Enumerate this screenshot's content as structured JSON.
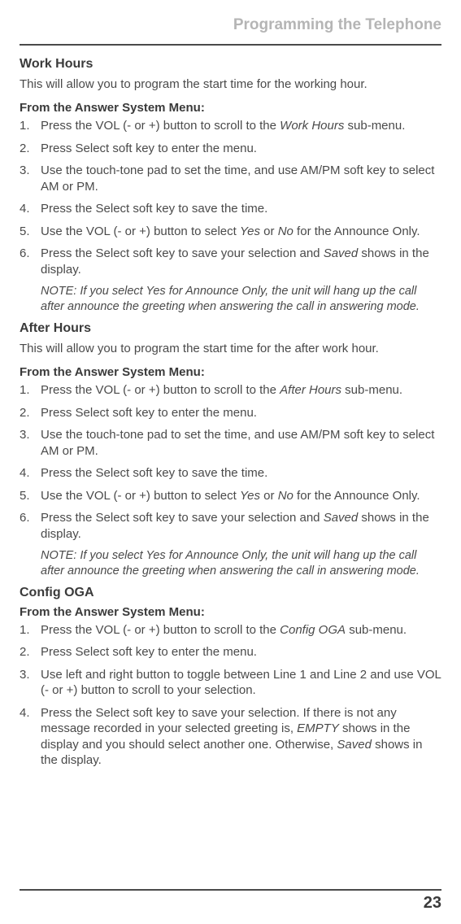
{
  "header": {
    "title": "Programming the Telephone"
  },
  "workHours": {
    "heading": "Work Hours",
    "intro": "This will allow you to program the start time for the working hour.",
    "subHeading": "From the Answer System Menu:",
    "steps": {
      "s1a": "Press the VOL (- or +) button to scroll to the ",
      "s1b": "Work Hours",
      "s1c": " sub-menu.",
      "s2": "Press Select soft key to enter the menu.",
      "s3": "Use the touch-tone pad to set the time, and use AM/PM soft key to select AM or PM.",
      "s4": "Press the Select soft key to save the time.",
      "s5a": "Use the VOL (- or +) button to select ",
      "s5b": "Yes",
      "s5c": " or ",
      "s5d": "No",
      "s5e": " for the Announce Only.",
      "s6a": "Press the Select soft key to save your selection and ",
      "s6b": "Saved",
      "s6c": " shows in the display."
    },
    "note": "NOTE: If you select Yes for Announce Only, the unit will hang up the call after announce the greeting when answering the call in answering mode."
  },
  "afterHours": {
    "heading": "After Hours",
    "intro": "This will allow you to program the start time for the after work hour.",
    "subHeading": "From the Answer System Menu:",
    "steps": {
      "s1a": "Press the VOL (- or +) button to scroll to the ",
      "s1b": "After Hours",
      "s1c": " sub-menu.",
      "s2": "Press Select soft key to enter the menu.",
      "s3": "Use the touch-tone pad to set the time, and use AM/PM soft key to select AM or PM.",
      "s4": "Press the Select soft key to save the time.",
      "s5a": "Use the VOL (- or +) button to select ",
      "s5b": "Yes",
      "s5c": " or ",
      "s5d": "No",
      "s5e": " for the Announce Only.",
      "s6a": "Press the Select soft key to save your selection and ",
      "s6b": "Saved",
      "s6c": " shows in the display."
    },
    "note": "NOTE: If you select Yes for Announce Only, the unit will hang up the call after announce the greeting when answering the call in answering mode."
  },
  "configOGA": {
    "heading": "Config OGA",
    "subHeading": "From the Answer System Menu:",
    "steps": {
      "s1a": "Press the VOL (- or +) button to scroll to the ",
      "s1b": "Config OGA",
      "s1c": " sub-menu.",
      "s2": "Press Select soft key to enter the menu.",
      "s3": "Use left and right button to toggle between Line 1 and Line 2 and use VOL (- or +) button to scroll to your selection.",
      "s4a": "Press the Select soft key to save your selection. If there is not any message recorded in your selected greeting is, ",
      "s4b": "EMPTY",
      "s4c": " shows in the display and you should select another one. Otherwise, ",
      "s4d": "Saved",
      "s4e": " shows in the display."
    }
  },
  "footer": {
    "pageNumber": "23"
  }
}
